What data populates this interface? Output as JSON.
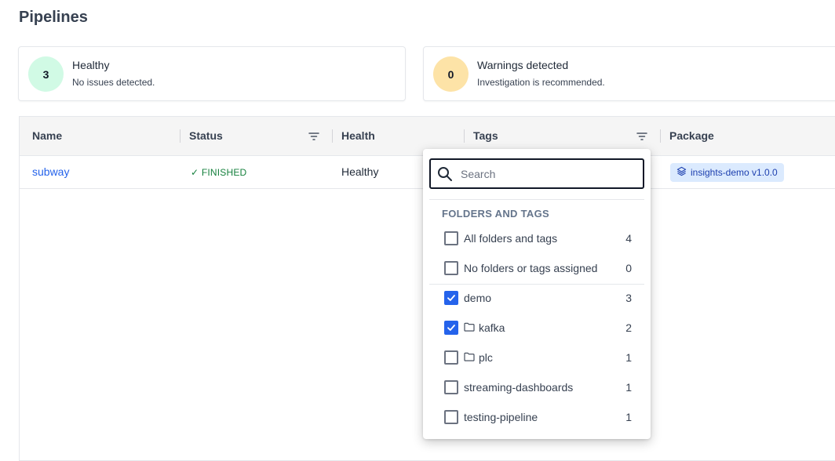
{
  "page": {
    "title": "Pipelines"
  },
  "summary": {
    "healthy": {
      "count": "3",
      "title": "Healthy",
      "subtitle": "No issues detected."
    },
    "warnings": {
      "count": "0",
      "title": "Warnings detected",
      "subtitle": "Investigation is recommended."
    }
  },
  "table": {
    "columns": [
      "Name",
      "Status",
      "Health",
      "Tags",
      "Package"
    ],
    "rows": [
      {
        "name": "subway",
        "status": "FINISHED",
        "health": "Healthy",
        "package": "insights-demo v1.0.0"
      }
    ]
  },
  "tag_filter": {
    "search_placeholder": "Search",
    "section_label": "FOLDERS AND TAGS",
    "options": [
      {
        "label": "All folders and tags",
        "count": "4",
        "checked": false,
        "folder": false
      },
      {
        "label": "No folders or tags assigned",
        "count": "0",
        "checked": false,
        "folder": false
      },
      {
        "label": "demo",
        "count": "3",
        "checked": true,
        "folder": false
      },
      {
        "label": "kafka",
        "count": "2",
        "checked": true,
        "folder": true
      },
      {
        "label": "plc",
        "count": "1",
        "checked": false,
        "folder": true
      },
      {
        "label": "streaming-dashboards",
        "count": "1",
        "checked": false,
        "folder": false
      },
      {
        "label": "testing-pipeline",
        "count": "1",
        "checked": false,
        "folder": false
      }
    ]
  },
  "icons": {
    "status": "check-icon",
    "package": "layers-icon",
    "filter": "filter-icon",
    "search": "search-icon",
    "folder": "folder-icon"
  },
  "colors": {
    "accent": "#2563eb",
    "healthy_bg": "#d1fae5",
    "warning_bg": "#fde3a7",
    "package_chip": "#dbeafe"
  }
}
